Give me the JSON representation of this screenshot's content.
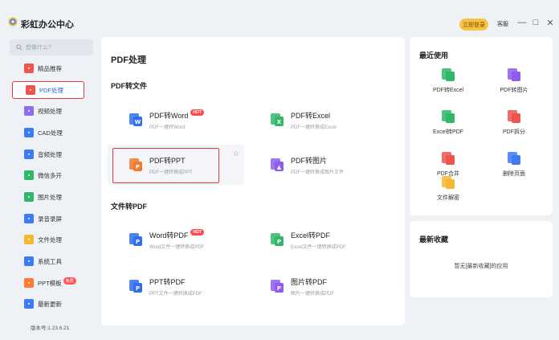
{
  "app": {
    "title": "彩虹办公中心",
    "login_label": "立即登录",
    "feedback_label": "客服",
    "minimize": "—",
    "maximize": "□",
    "close": "✕"
  },
  "sidebar": {
    "search_placeholder": "想做什么?",
    "items": [
      {
        "label": "精品推荐",
        "icon": "recommend-icon",
        "color": "#ef5350"
      },
      {
        "label": "PDF处理",
        "icon": "pdf-icon",
        "color": "#ef5350",
        "active": true
      },
      {
        "label": "视频处理",
        "icon": "video-icon",
        "color": "#8e6cf0"
      },
      {
        "label": "CAD处理",
        "icon": "cad-icon",
        "color": "#3d7bf5"
      },
      {
        "label": "音频处理",
        "icon": "audio-icon",
        "color": "#3d7bf5"
      },
      {
        "label": "微信多开",
        "icon": "wechat-icon",
        "color": "#2fb86a"
      },
      {
        "label": "图片处理",
        "icon": "image-icon",
        "color": "#2fb86a"
      },
      {
        "label": "录音录屏",
        "icon": "record-icon",
        "color": "#3d7bf5"
      },
      {
        "label": "文件处理",
        "icon": "folder-icon",
        "color": "#f5b731"
      },
      {
        "label": "系统工具",
        "icon": "system-icon",
        "color": "#3d7bf5"
      },
      {
        "label": "PPT模板",
        "icon": "ppt-icon",
        "color": "#ff7a2d",
        "badge": "免费"
      },
      {
        "label": "最新更新",
        "icon": "update-icon",
        "color": "#3d7bf5"
      }
    ],
    "version": "版本号:1.23.6.21"
  },
  "main": {
    "title": "PDF处理",
    "section1": "PDF转文件",
    "section2": "文件转PDF",
    "cards": [
      {
        "title": "PDF转Word",
        "sub": "PDF一键转Word",
        "hot": "HOT",
        "icon": "pdf-to-word-icon",
        "color": "#2f6ff0",
        "letter": "W"
      },
      {
        "title": "PDF转Excel",
        "sub": "PDF一键转换成Excel",
        "icon": "pdf-to-excel-icon",
        "color": "#2fb86a",
        "letter": "X"
      },
      {
        "title": "PDF转PPT",
        "sub": "PDF一键转换成PPT",
        "icon": "pdf-to-ppt-icon",
        "color": "#f07a2d",
        "letter": "P"
      },
      {
        "title": "PDF转图片",
        "sub": "PDF一键转换成图片文件",
        "icon": "pdf-to-image-icon",
        "color": "#8e5cf0",
        "letter": "▲"
      },
      {
        "title": "Word转PDF",
        "sub": "Word文件一键转换成PDF",
        "hot": "HOT",
        "icon": "word-to-pdf-icon",
        "color": "#2f6ff0",
        "letter": "P"
      },
      {
        "title": "Excel转PDF",
        "sub": "Excel文件一键转换成PDF",
        "icon": "excel-to-pdf-icon",
        "color": "#2fb86a",
        "letter": "P"
      },
      {
        "title": "PPT转PDF",
        "sub": "PPT文件一键转换成PDF",
        "icon": "ppt-to-pdf-icon",
        "color": "#2f6ff0",
        "letter": "P"
      },
      {
        "title": "图片转PDF",
        "sub": "图片一键转换成PDF",
        "icon": "image-to-pdf-icon",
        "color": "#8e5cf0",
        "letter": "P"
      }
    ]
  },
  "recent": {
    "title": "最近使用",
    "items": [
      {
        "label": "PDF转Excel",
        "icon": "pdf-to-excel-icon",
        "color": "#2fb86a"
      },
      {
        "label": "PDF转图片",
        "icon": "pdf-to-image-icon",
        "color": "#8e5cf0"
      },
      {
        "label": "Excel转PDF",
        "icon": "excel-to-pdf-icon",
        "color": "#2fb86a"
      },
      {
        "label": "PDF拆分",
        "icon": "pdf-split-icon",
        "color": "#ef5350"
      },
      {
        "label": "PDF合并",
        "icon": "pdf-merge-icon",
        "color": "#ef5350"
      },
      {
        "label": "删除页面",
        "icon": "delete-page-icon",
        "color": "#3d7bf5"
      },
      {
        "label": "文件解密",
        "icon": "file-decrypt-icon",
        "color": "#f5b731"
      }
    ]
  },
  "favorites": {
    "title": "最新收藏",
    "empty_text": "暂无[最新收藏]的应用"
  }
}
